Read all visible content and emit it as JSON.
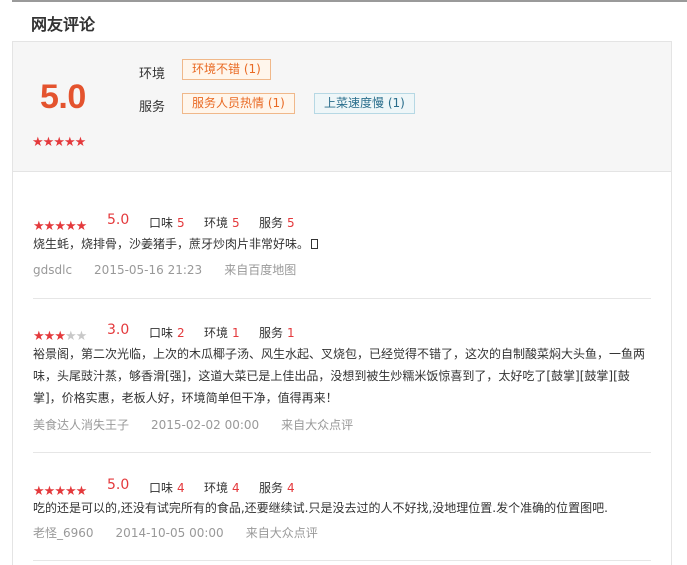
{
  "title": "网友评论",
  "summary": {
    "score": "5.0",
    "stars": 5,
    "categories": [
      {
        "label": "环境",
        "tags": [
          {
            "text": "环境不错 (1)",
            "tone": "positive"
          }
        ]
      },
      {
        "label": "服务",
        "tags": [
          {
            "text": "服务人员热情 (1)",
            "tone": "positive"
          },
          {
            "text": "上菜速度慢 (1)",
            "tone": "negative"
          }
        ]
      }
    ]
  },
  "reviews": [
    {
      "stars": 5,
      "score": "5.0",
      "taste_label": "口味",
      "taste": "5",
      "env_label": "环境",
      "env": "5",
      "service_label": "服务",
      "service": "5",
      "text": "烧生蚝，烧排骨，沙姜猪手，蔗牙炒肉片非常好味。",
      "author": "gdsdlc",
      "date": "2015-05-16 21:23",
      "source": "来自百度地图"
    },
    {
      "stars": 3,
      "score": "3.0",
      "taste_label": "口味",
      "taste": "2",
      "env_label": "环境",
      "env": "1",
      "service_label": "服务",
      "service": "1",
      "text": "裕景阁，第二次光临，上次的木瓜椰子汤、风生水起、叉烧包，已经觉得不错了，这次的自制酸菜焖大头鱼，一鱼两味，头尾豉汁蒸，够香滑[强]，这道大菜已是上佳出品，没想到被生炒糯米饭惊喜到了，太好吃了[鼓掌][鼓掌][鼓掌]，价格实惠，老板人好，环境简单但干净，值得再来！",
      "author": "美食达人消失王子",
      "date": "2015-02-02 00:00",
      "source": "来自大众点评"
    },
    {
      "stars": 5,
      "score": "5.0",
      "taste_label": "口味",
      "taste": "4",
      "env_label": "环境",
      "env": "4",
      "service_label": "服务",
      "service": "4",
      "text": "吃的还是可以的,还没有试完所有的食品,还要继续试.只是没去过的人不好找,没地理位置.发个准确的位置图吧.",
      "author": "老怪_6960",
      "date": "2014-10-05 00:00",
      "source": "来自大众点评"
    }
  ],
  "colors": {
    "accent": "#e4393c",
    "score": "#e4532e",
    "positive_tag": "#e96a24",
    "negative_tag": "#2a6e8c"
  }
}
